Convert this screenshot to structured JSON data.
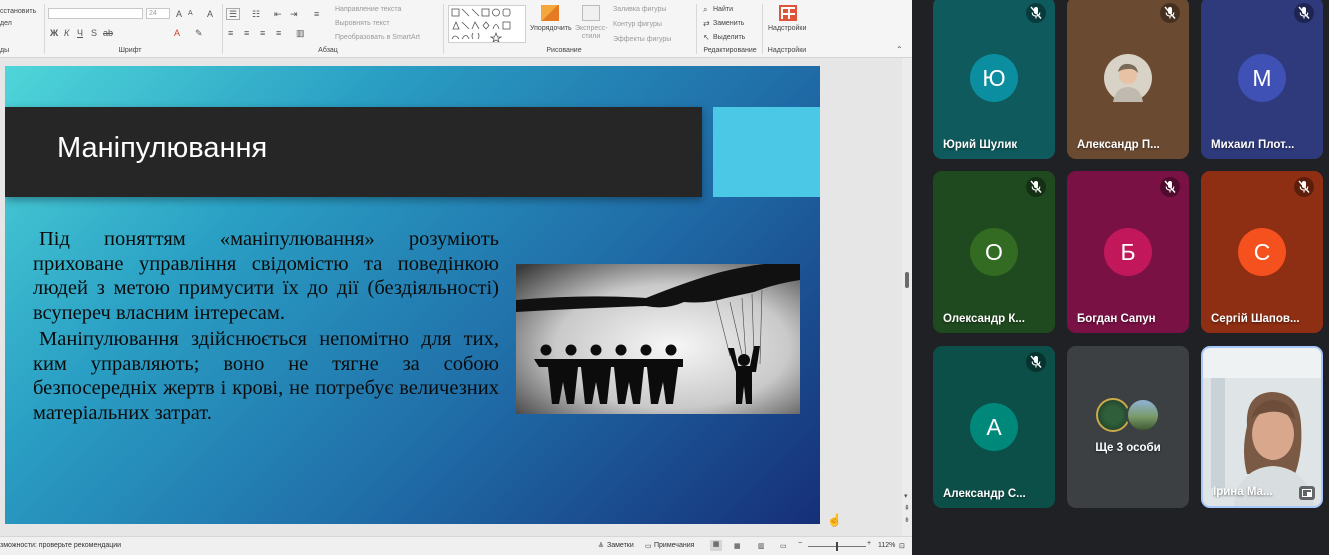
{
  "ribbon": {
    "reset_label": "сстановить",
    "section_label": "дел",
    "groups": {
      "slides_tail": "ды",
      "font": "Шрифт",
      "paragraph": "Абзац",
      "drawing": "Рисование",
      "editing": "Редактирование",
      "addins": "Надстройки"
    },
    "font_size_value": "24",
    "font_buttons": [
      "Ж",
      "К",
      "Ч",
      "S",
      "ab"
    ],
    "paragraph_commands": [
      "Направление текста",
      "Выровнять текст",
      "Преобразовать в SmartArt"
    ],
    "arrange_label": "Упорядочить",
    "quick_styles_label": "Экспресс-стили",
    "shape_commands": [
      "Заливка фигуры",
      "Контур фигуры",
      "Эффекты фигуры"
    ],
    "editing_commands": [
      "Найти",
      "Заменить",
      "Выделить"
    ],
    "addins_label": "Надстройки"
  },
  "slide": {
    "title": "Маніпулювання",
    "paragraphs": [
      "Під поняттям «маніпулювання» розуміють приховане управління свідомістю та поведінкою людей з метою примусити їх до дії (бездіяльності) всупереч власним інтересам.",
      "Маніпулювання здійснюється непомітно для тих, ким управляють; воно не тягне за собою безпосередніх жертв і крові, не потребує величезних матеріальних затрат."
    ]
  },
  "statusbar": {
    "accessibility_text": "зможности: проверьте рекомендации",
    "notes_label": "Заметки",
    "comments_label": "Примечания",
    "zoom_minus": "−",
    "zoom_plus": "+",
    "zoom_value": "112%"
  },
  "participants": [
    {
      "name": "Юрий Шулик",
      "initial": "Ю",
      "muted": true,
      "tile_color": "#0f5a5c",
      "avatar_color": "#0b8fa0",
      "type": "initial"
    },
    {
      "name": "Александр П...",
      "initial": "",
      "muted": true,
      "tile_color": "#6b4a32",
      "avatar_color": "#d9d2c6",
      "type": "photo"
    },
    {
      "name": "Михаил Плот...",
      "initial": "М",
      "muted": true,
      "tile_color": "#2e3a7c",
      "avatar_color": "#3f51b5",
      "type": "initial"
    },
    {
      "name": "Олександр К...",
      "initial": "О",
      "muted": true,
      "tile_color": "#1f4a1f",
      "avatar_color": "#336b22",
      "type": "initial"
    },
    {
      "name": "Богдан Сапун",
      "initial": "Б",
      "muted": true,
      "tile_color": "#7a1145",
      "avatar_color": "#c2185b",
      "type": "initial"
    },
    {
      "name": "Сергій Шапов...",
      "initial": "С",
      "muted": true,
      "tile_color": "#8e2e12",
      "avatar_color": "#f4511e",
      "type": "initial"
    },
    {
      "name": "Александр С...",
      "initial": "А",
      "muted": true,
      "tile_color": "#0c4f49",
      "avatar_color": "#00897b",
      "type": "initial"
    },
    {
      "name": "Ще 3 особи",
      "initial": "",
      "muted": false,
      "tile_color": "#3c4043",
      "avatar_color": "#3c4043",
      "type": "group"
    },
    {
      "name": "Ірина Ма...",
      "initial": "",
      "muted": false,
      "tile_color": "#cfd6da",
      "avatar_color": "#8a6a55",
      "type": "video"
    }
  ]
}
